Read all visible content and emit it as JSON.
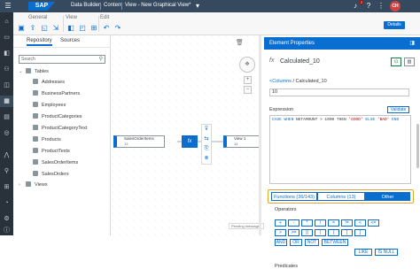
{
  "shell": {
    "logo": "SAP",
    "app": "Data Builder",
    "section": "Content",
    "view_title": "View - New Graphical View*",
    "notifications_count": "2",
    "avatar_initials": "CH"
  },
  "toolbar": {
    "general_label": "General",
    "view_label": "View",
    "edit_label": "Edit",
    "details_label": "Details"
  },
  "repository": {
    "tab_repository": "Repository",
    "tab_sources": "Sources",
    "search_placeholder": "Search",
    "tables_label": "Tables",
    "tables": [
      "Addresses",
      "BusinessPartners",
      "Employees",
      "ProductCategories",
      "ProductCategoryText",
      "Products",
      "ProductTexts",
      "SalesOrderItems",
      "SalesOrders"
    ],
    "views_label": "Views"
  },
  "canvas": {
    "source_node": "SalesOrderItems",
    "source_node_sub": "13",
    "calc_node_icon": "fx",
    "output_node": "View 1",
    "output_node_sub": "14",
    "pending_label": "Pending messages"
  },
  "properties": {
    "header": "Element Properties",
    "name": "Calculated_10",
    "crumb_link": "<Columns",
    "crumb_current": "/ Calculated_10",
    "column_name_value": "10",
    "expression_label": "Expression",
    "validate_label": "Validate",
    "expression": {
      "case": "CASE WHEN",
      "field": "NETAMOUNT",
      "cmp": "> 1000 THEN",
      "good": "'GOOD'",
      "else": "ELSE",
      "bad": "'BAD'",
      "end": "END"
    },
    "tabs": {
      "functions": "Functions (36/143)",
      "columns": "Columns (13)",
      "other": "Other"
    },
    "operators_label": "Operators",
    "operators_row1": [
      "+",
      "-",
      "*",
      "/",
      "=",
      "!=",
      "<",
      "<="
    ],
    "operators_row2": [
      ">",
      ">=",
      "||",
      "(",
      ")",
      "[",
      "]"
    ],
    "operators_row3": [
      "AND",
      "OR",
      "NOT",
      "BETWEEN"
    ],
    "operators_row4": [
      "LIKE",
      "IS NULL"
    ],
    "predicates_label": "Predicates"
  },
  "colors": {
    "shell": "#354a5f",
    "accent": "#0a6ed1",
    "highlight": "#e9a52b",
    "sidebar": "#29313a"
  }
}
